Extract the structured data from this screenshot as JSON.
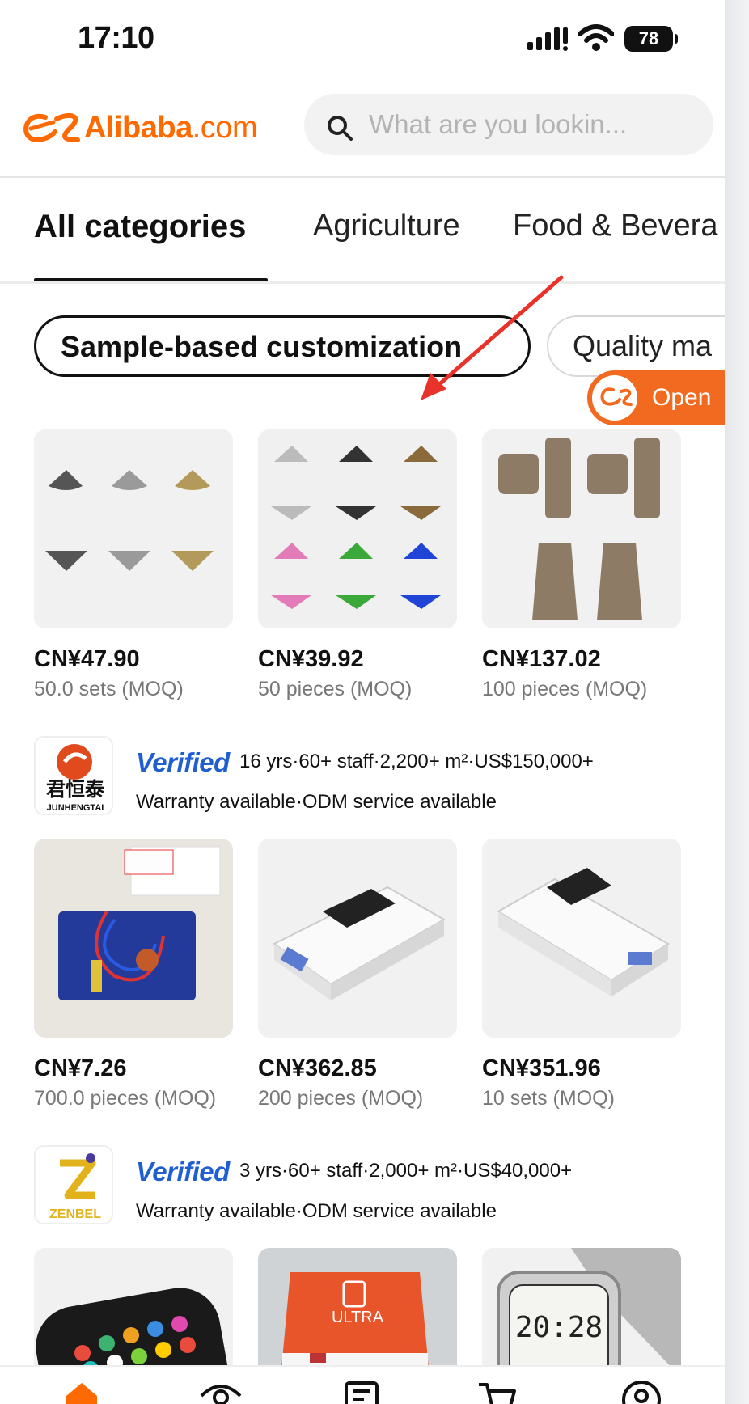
{
  "status_bar": {
    "time": "17:10",
    "battery": "78"
  },
  "header": {
    "logo_text": "Alibaba",
    "logo_domain": ".com",
    "search_placeholder": "What are you lookin..."
  },
  "tabs": [
    {
      "label": "All categories",
      "active": true
    },
    {
      "label": "Agriculture",
      "active": false
    },
    {
      "label": "Food & Bevera",
      "active": false
    }
  ],
  "chips": [
    {
      "label": "Sample-based customization",
      "selected": true
    },
    {
      "label": "Quality ma",
      "selected": false
    }
  ],
  "open_button": {
    "label": "Open"
  },
  "groups": [
    {
      "products": [
        {
          "price": "CN¥47.90",
          "moq": "50.0 sets (MOQ)",
          "image": "bikini-sets-image"
        },
        {
          "price": "CN¥39.92",
          "moq": "50 pieces (MOQ)",
          "image": "printed-bikini-image"
        },
        {
          "price": "CN¥137.02",
          "moq": "100 pieces (MOQ)",
          "image": "brown-loungewear-image"
        }
      ]
    },
    {
      "supplier": {
        "logo_text": "君恒泰",
        "logo_subtext": "JUNHENGTAI",
        "verified": "Verified",
        "facts": "16 yrs·60+ staff·2,200+ m²·US$150,000+",
        "services": "Warranty available·ODM service available"
      },
      "products": [
        {
          "price": "CN¥7.26",
          "moq": "700.0 pieces (MOQ)",
          "image": "circuit-board-image"
        },
        {
          "price": "CN¥362.85",
          "moq": "200 pieces (MOQ)",
          "image": "programmer-device-image"
        },
        {
          "price": "CN¥351.96",
          "moq": "10 sets (MOQ)",
          "image": "programmer-device-2-image"
        }
      ]
    },
    {
      "supplier": {
        "logo_text": "ZENBEL",
        "verified": "Verified",
        "facts": "3 yrs·60+ staff·2,000+ m²·US$40,000+",
        "services": "Warranty available·ODM service available"
      },
      "products": [
        {
          "image": "smartwatch-image"
        },
        {
          "image": "ultra-watch-box-image",
          "box_text": "ULTRA"
        },
        {
          "image": "silver-smartwatch-image",
          "watch_time": "20:28"
        }
      ]
    }
  ],
  "colors": {
    "brand": "#ff6a00",
    "verified": "#1f5fd0",
    "open": "#f16a1f",
    "annotation": "#e8322a"
  }
}
